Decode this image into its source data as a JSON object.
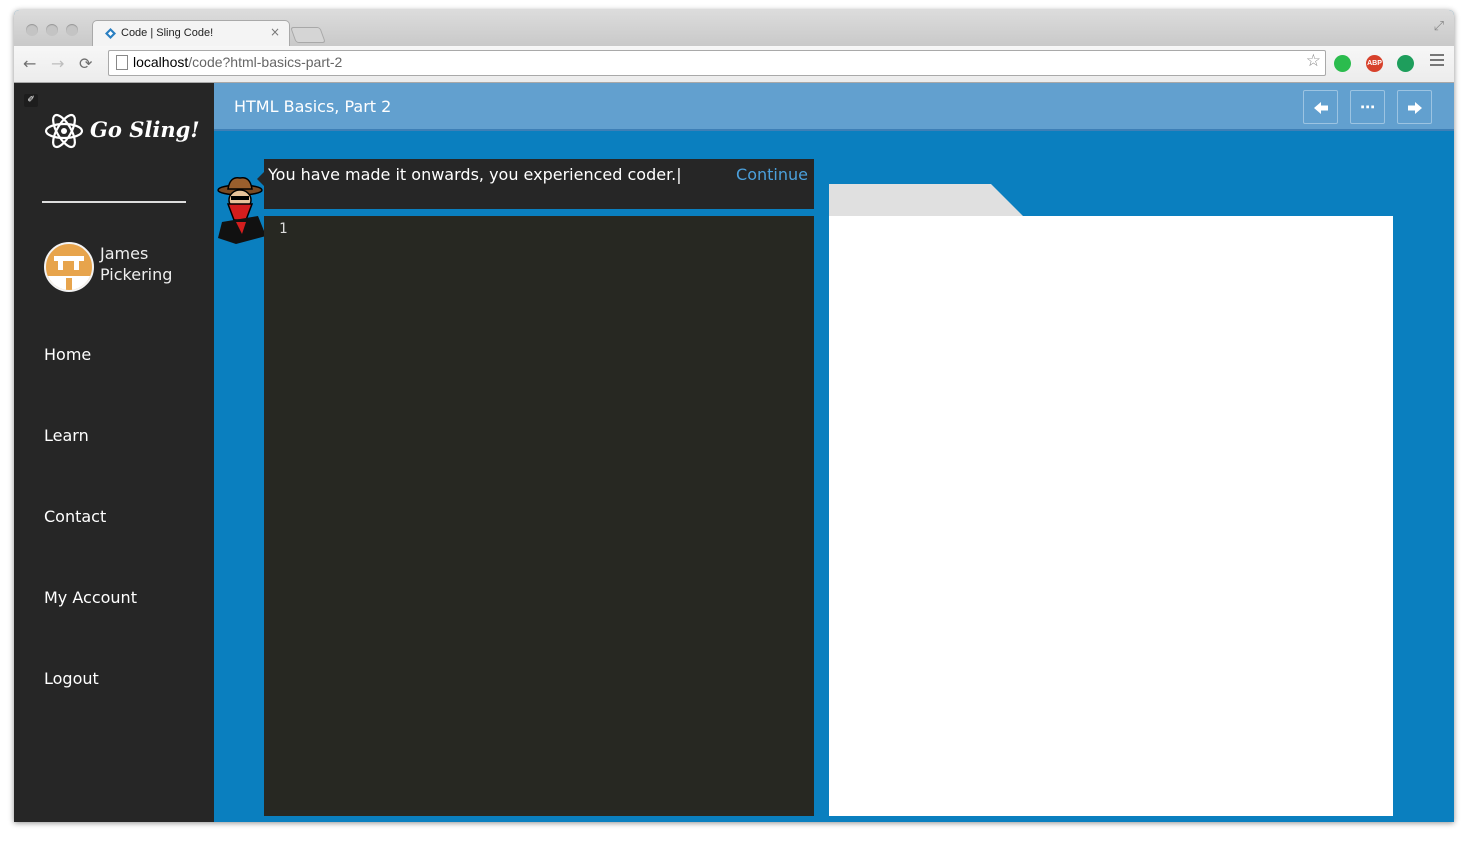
{
  "browser": {
    "tab_title": "Code | Sling Code!",
    "tab_close": "×",
    "url_host": "localhost",
    "url_path": "/code?html-basics-part-2",
    "nav_back": "←",
    "nav_forward": "→",
    "nav_reload": "⟳",
    "bookmark_star": "☆",
    "fullscreen_icon": "⤢",
    "extensions": [
      {
        "name": "evernote-icon",
        "label": "",
        "color": "#2bbc4e"
      },
      {
        "name": "adblock-icon",
        "label": "ABP",
        "color": "#d7412b"
      },
      {
        "name": "grammarly-icon",
        "label": "",
        "color": "#1e9e5c"
      }
    ]
  },
  "sidebar": {
    "logo_text": "Go Sling!",
    "user_name": "James Pickering",
    "nav": [
      "Home",
      "Learn",
      "Contact",
      "My Account",
      "Logout"
    ]
  },
  "header": {
    "title": "HTML Basics, Part 2",
    "prev_icon": "🡄",
    "more_icon": "⋯",
    "next_icon": "🡆"
  },
  "lesson": {
    "message": "You have made it onwards, you experienced coder.|",
    "continue_label": "Continue",
    "line_number": "1"
  },
  "preview": {
    "icon_glyph": "✐"
  },
  "colors": {
    "page_bg": "#0a7fbf",
    "sidebar_bg": "#262626",
    "topbar_bg": "#62a0cf",
    "editor_bg": "#272822",
    "link": "#4ba0dc"
  }
}
